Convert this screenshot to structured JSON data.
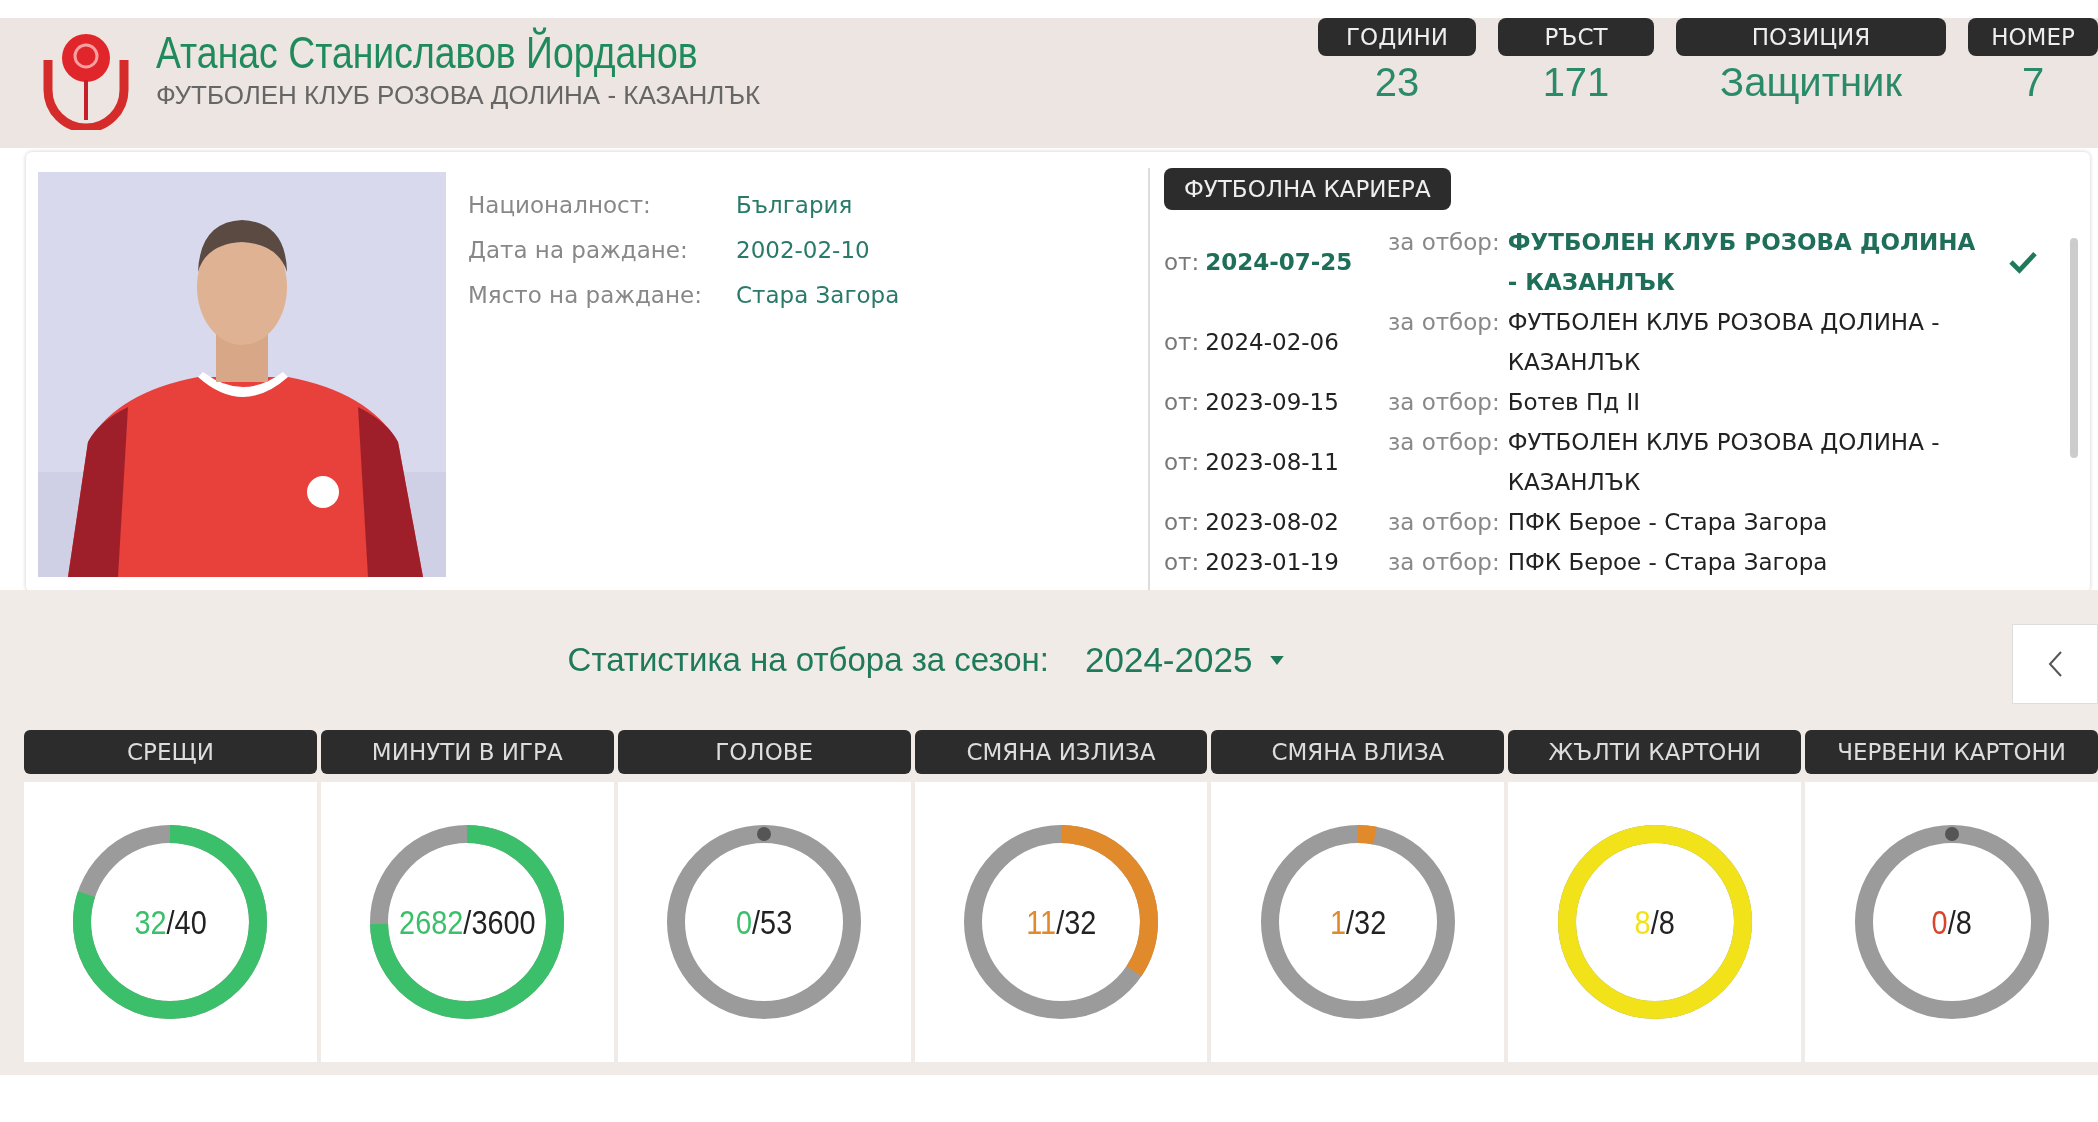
{
  "player": {
    "name": "Атанас Станиславов Йорданов",
    "club": "ФУТБОЛЕН КЛУБ РОЗОВА ДОЛИНА - КАЗАНЛЪК"
  },
  "facts": [
    {
      "label": "ГОДИНИ",
      "value": "23"
    },
    {
      "label": "РЪСТ",
      "value": "171"
    },
    {
      "label": "ПОЗИЦИЯ",
      "value": "Защитник"
    },
    {
      "label": "НОМЕР",
      "value": "7"
    }
  ],
  "details": [
    {
      "label": "Националност:",
      "value": "България"
    },
    {
      "label": "Дата на раждане:",
      "value": "2002-02-10"
    },
    {
      "label": "Място на раждане:",
      "value": "Стара Загора"
    }
  ],
  "career": {
    "title": "ФУТБОЛНА КАРИЕРА",
    "rows": [
      {
        "from": "от:",
        "date": "2024-07-25",
        "team_label": "за отбор:",
        "team": "ФУТБОЛЕН КЛУБ РОЗОВА ДОЛИНА - КАЗАНЛЪК",
        "current": true
      },
      {
        "from": "от:",
        "date": "2024-02-06",
        "team_label": "за отбор:",
        "team": "ФУТБОЛЕН КЛУБ РОЗОВА ДОЛИНА - КАЗАНЛЪК",
        "current": false
      },
      {
        "from": "от:",
        "date": "2023-09-15",
        "team_label": "за отбор:",
        "team": "Ботев Пд II",
        "current": false
      },
      {
        "from": "от:",
        "date": "2023-08-11",
        "team_label": "за отбор:",
        "team": "ФУТБОЛЕН КЛУБ РОЗОВА ДОЛИНА - КАЗАНЛЪК",
        "current": false
      },
      {
        "from": "от:",
        "date": "2023-08-02",
        "team_label": "за отбор:",
        "team": "ПФК Берое - Стара Загора",
        "current": false
      },
      {
        "from": "от:",
        "date": "2023-01-19",
        "team_label": "за отбор:",
        "team": "ПФК Берое - Стара Загора",
        "current": false
      }
    ]
  },
  "season": {
    "label": "Статистика на отбора за сезон:",
    "value": "2024-2025"
  },
  "stats": [
    {
      "title": "СРЕЩИ",
      "value": "32",
      "total": "/40",
      "level": 0.8,
      "color": "#3cbf6a"
    },
    {
      "title": "МИНУТИ В ИГРА",
      "value": "2682",
      "total": "/3600",
      "level": 0.745,
      "color": "#3cbf6a"
    },
    {
      "title": "ГОЛОВЕ",
      "value": "0",
      "total": "/53",
      "level": 0,
      "color": "#3cbf6a"
    },
    {
      "title": "СМЯНА ИЗЛИЗА",
      "value": "11",
      "total": "/32",
      "level": 0.344,
      "color": "#e08a2c"
    },
    {
      "title": "СМЯНА ВЛИЗА",
      "value": "1",
      "total": "/32",
      "level": 0.031,
      "color": "#e08a2c"
    },
    {
      "title": "ЖЪЛТИ КАРТОНИ",
      "value": "8",
      "total": "/8",
      "level": 1,
      "color": "#f2e21a"
    },
    {
      "title": "ЧЕРВЕНИ КАРТОНИ",
      "value": "0",
      "total": "/8",
      "level": 0,
      "color": "#d9442c"
    }
  ]
}
